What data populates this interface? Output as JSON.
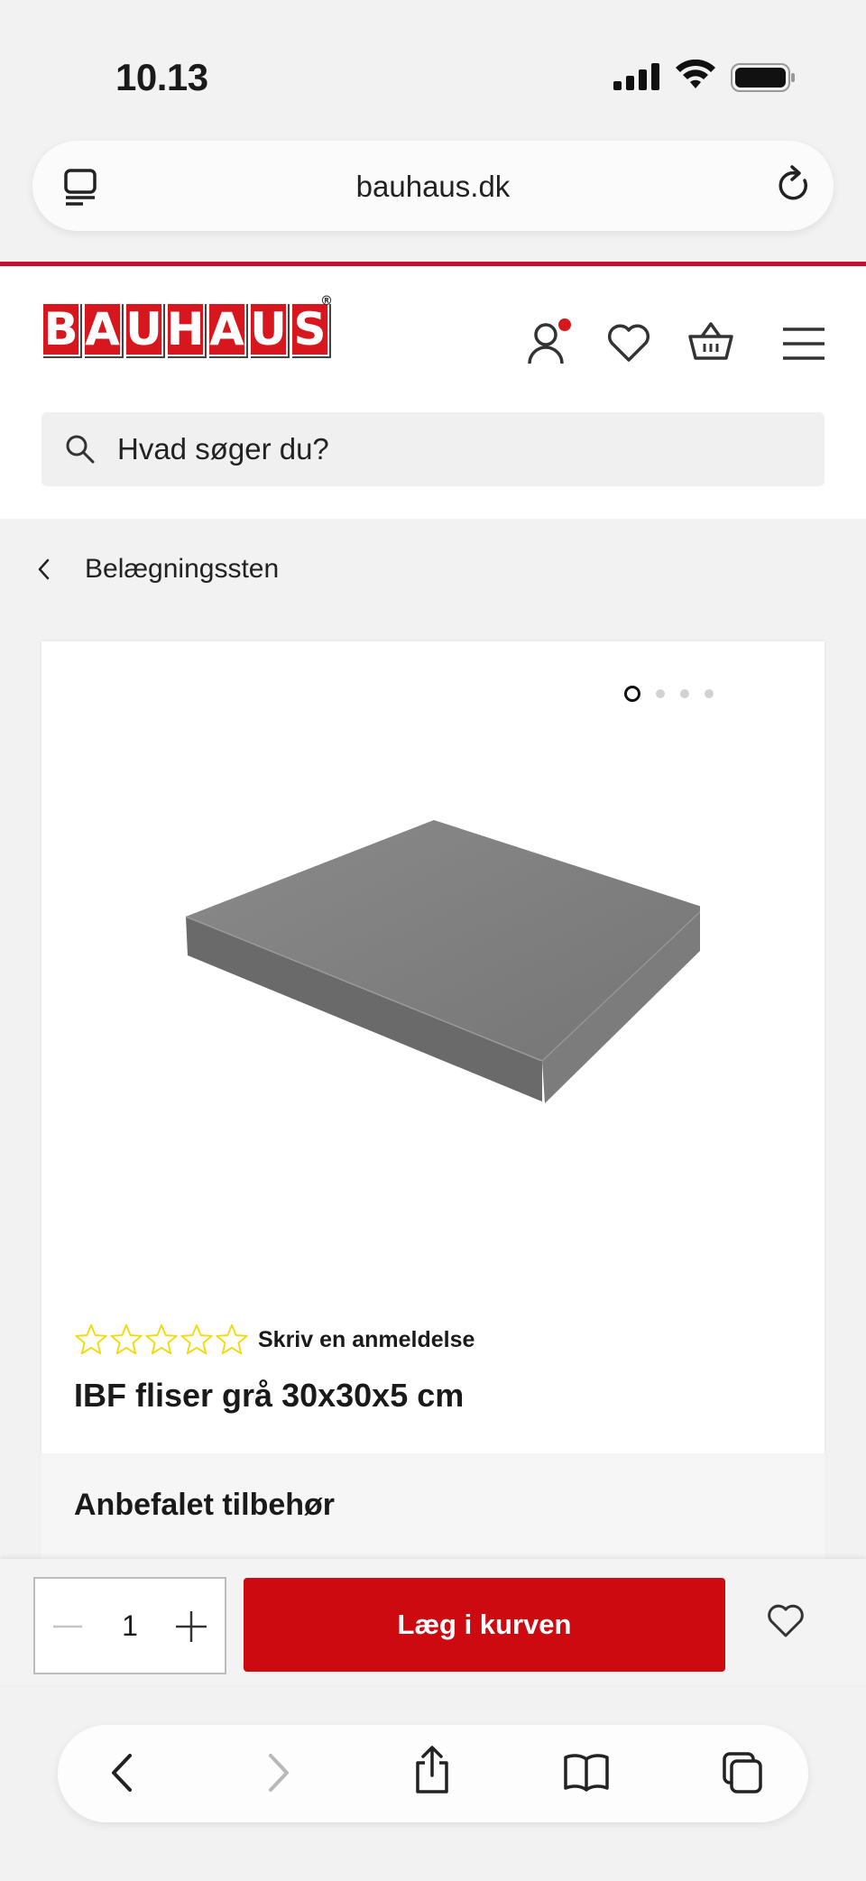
{
  "status_bar": {
    "time": "10.13"
  },
  "browser": {
    "domain": "bauhaus.dk"
  },
  "header": {
    "logo_letters": [
      "B",
      "A",
      "U",
      "H",
      "A",
      "U",
      "S"
    ],
    "search_placeholder": "Hvad søger du?"
  },
  "breadcrumb": {
    "label": "Belægningssten"
  },
  "product": {
    "image_count": 4,
    "active_image": 1,
    "rating_stars": 5,
    "review_link": "Skriv en anmeldelse",
    "title": "IBF fliser grå 30x30x5 cm",
    "accessories_heading": "Anbefalet tilbehør"
  },
  "buy_bar": {
    "quantity": "1",
    "add_to_cart": "Læg i kurven"
  },
  "colors": {
    "brand_red": "#d7161e",
    "button_red": "#cc0a0f",
    "star_yellow": "#f5d90a"
  },
  "icons": [
    "tabs-icon",
    "reload-icon",
    "account-icon",
    "heart-icon",
    "basket-icon",
    "menu-icon",
    "search-icon",
    "chevron-left-icon",
    "star-icon",
    "minus-icon",
    "plus-icon",
    "back-icon",
    "forward-icon",
    "share-icon",
    "bookmarks-icon",
    "tabs-overview-icon"
  ]
}
